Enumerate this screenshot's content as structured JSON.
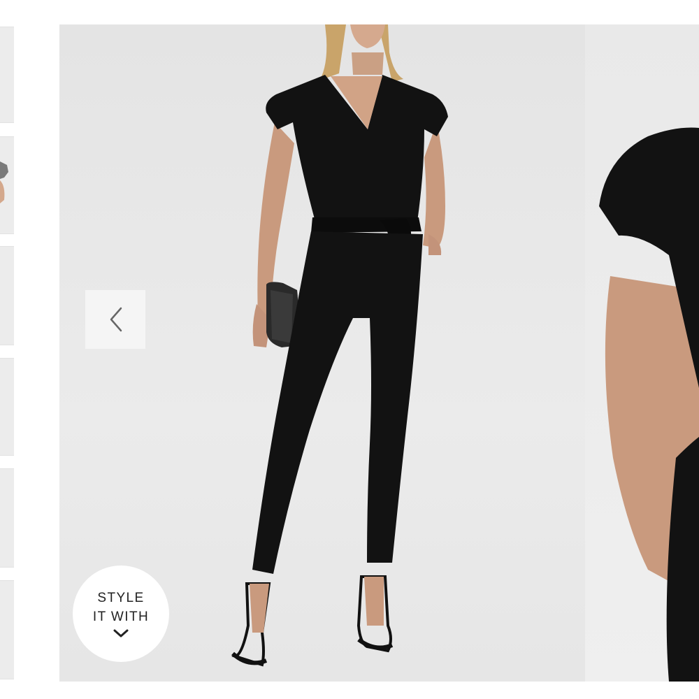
{
  "gallery": {
    "thumbnails": [
      {
        "label": "thumbnail-1"
      },
      {
        "label": "thumbnail-2"
      },
      {
        "label": "thumbnail-3"
      },
      {
        "label": "thumbnail-4"
      },
      {
        "label": "thumbnail-5"
      },
      {
        "label": "thumbnail-6"
      }
    ],
    "prev_icon": "chevron-left-icon",
    "style_button": {
      "line1": "STYLE",
      "line2": "IT WITH",
      "icon": "chevron-down-icon"
    }
  },
  "colors": {
    "background": "#ffffff",
    "photo_background": "#e8e8e8",
    "garment": "#121212",
    "skin": "#c99a7e"
  }
}
